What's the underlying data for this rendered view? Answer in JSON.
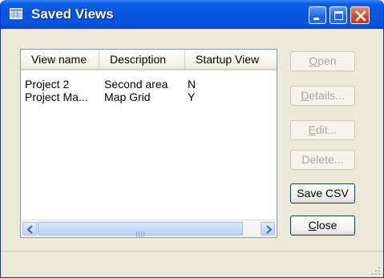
{
  "window": {
    "title": "Saved Views",
    "icon": "grid-window-icon"
  },
  "titlebar_buttons": {
    "minimize": "minimize-icon",
    "maximize": "maximize-icon",
    "close": "close-icon"
  },
  "list": {
    "columns": [
      "View name",
      "Description",
      "Startup View"
    ],
    "rows": [
      {
        "name": "Project 2",
        "description": "Second area",
        "startup": "N"
      },
      {
        "name": "Project Ma...",
        "description": "Map Grid",
        "startup": "Y"
      }
    ]
  },
  "buttons": {
    "open": {
      "label": "Open",
      "mnemonic": "O",
      "rest": "pen",
      "enabled": false
    },
    "details": {
      "label": "Details...",
      "mnemonic": "D",
      "rest": "etails...",
      "enabled": false
    },
    "edit": {
      "label": "Edit...",
      "mnemonic": "E",
      "rest": "dit...",
      "enabled": false
    },
    "delete": {
      "label": "Delete...",
      "enabled": false
    },
    "save_csv": {
      "label": "Save CSV",
      "enabled": true
    },
    "close": {
      "label": "Close",
      "mnemonic": "C",
      "rest": "lose",
      "enabled": true
    }
  },
  "colors": {
    "titlebar": "#0855dd",
    "face": "#ece9d8",
    "close": "#d54a22"
  }
}
